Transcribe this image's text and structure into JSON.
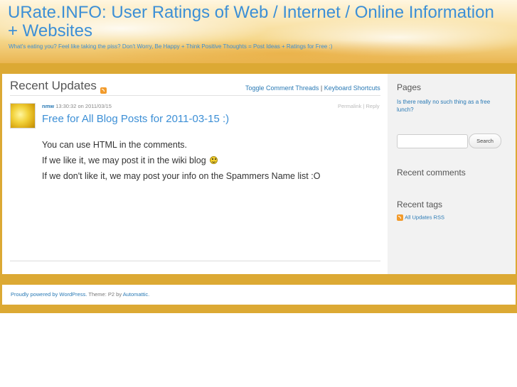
{
  "header": {
    "title": "URate.INFO: User Ratings of Web / Internet / Online Information + Websites",
    "description": "What's eating you? Feel like taking the piss? Don't Worry, Be Happy + Think Positive Thoughts = Post Ideas + Ratings for Free :)"
  },
  "content": {
    "heading": "Recent Updates",
    "toggle_threads": "Toggle Comment Threads",
    "separator": "|",
    "keyboard_shortcuts": "Keyboard Shortcuts"
  },
  "post": {
    "author": "nmw",
    "time": "13:30:32",
    "on": "on",
    "date": "2011/03/15",
    "permalink": "Permalink",
    "reply": "Reply",
    "action_separator": "|",
    "title": "Free for All Blog Posts for 2011-03-15 :)",
    "line1": "You can use HTML in the comments.",
    "line2": "If we like it, we may post it in the wiki blog",
    "line3": "If we don't like it, we may post your info on the Spammers Name list :O"
  },
  "sidebar": {
    "pages_heading": "Pages",
    "pages_link": "Is there really no such thing as a free lunch?",
    "search_placeholder": "",
    "search_button": "Search",
    "recent_comments_heading": "Recent comments",
    "recent_tags_heading": "Recent tags",
    "all_updates_rss": "All Updates RSS"
  },
  "footer": {
    "powered": "Proudly powered by WordPress.",
    "theme": "Theme: P2 by",
    "automattic": "Automattic."
  },
  "colors": {
    "accent": "#3c8fd6",
    "band": "#dca934",
    "rss": "#f29b2c"
  }
}
